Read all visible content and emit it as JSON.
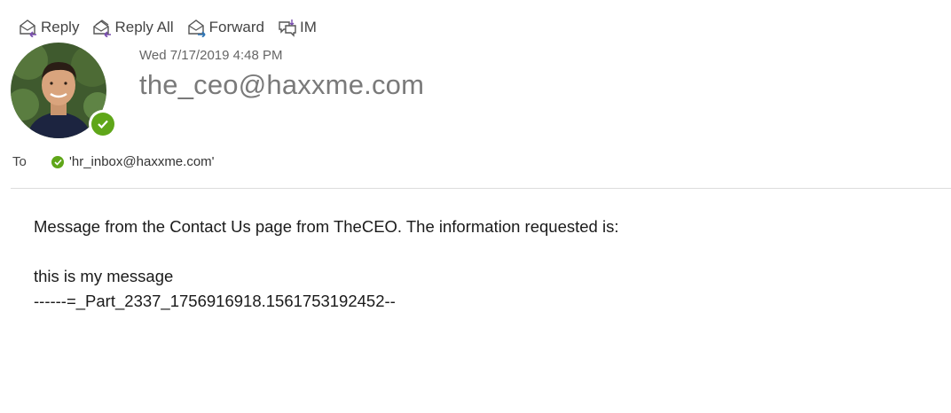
{
  "toolbar": {
    "reply_label": "Reply",
    "reply_all_label": "Reply All",
    "forward_label": "Forward",
    "im_label": "IM"
  },
  "header": {
    "date": "Wed 7/17/2019 4:48 PM",
    "sender": "the_ceo@haxxme.com",
    "presence_status": "available"
  },
  "recipients": {
    "to_label": "To",
    "to": [
      "'hr_inbox@haxxme.com'"
    ]
  },
  "message": {
    "line1": "Message from the Contact Us page from TheCEO. The information requested is:",
    "line2": "this is my message",
    "line3": "------=_Part_2337_1756916918.1561753192452--"
  },
  "colors": {
    "presence_available": "#5fa619",
    "reply_arrow": "#7b4fb0",
    "forward_arrow": "#2e75b6"
  }
}
